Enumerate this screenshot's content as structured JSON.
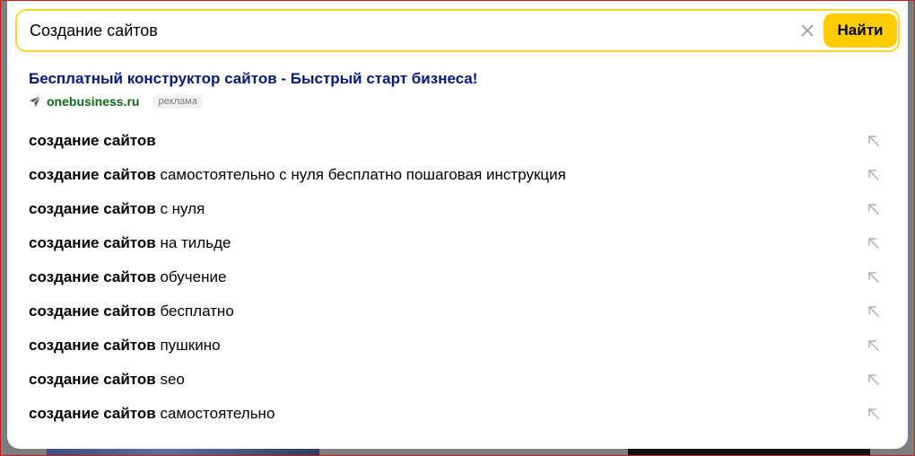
{
  "search": {
    "value": "Создание сайтов",
    "button_label": "Найти"
  },
  "ad": {
    "title": "Бесплатный конструктор сайтов - Быстрый старт бизнеса!",
    "domain": "onebusiness.ru",
    "badge": "реклама"
  },
  "suggestions": [
    {
      "bold": "создание сайтов",
      "rest": ""
    },
    {
      "bold": "создание сайтов",
      "rest": " самостоятельно с нуля бесплатно пошаговая инструкция"
    },
    {
      "bold": "создание сайтов",
      "rest": " с нуля"
    },
    {
      "bold": "создание сайтов",
      "rest": " на тильде"
    },
    {
      "bold": "создание сайтов",
      "rest": " обучение"
    },
    {
      "bold": "создание сайтов",
      "rest": " бесплатно"
    },
    {
      "bold": "создание сайтов",
      "rest": " пушкино"
    },
    {
      "bold": "создание сайтов",
      "rest": " seo"
    },
    {
      "bold": "создание сайтов",
      "rest": " самостоятельно"
    }
  ],
  "icons": {
    "clear": "close-icon",
    "ad_marker": "navigation-arrow-icon",
    "fill": "arrow-up-left-icon"
  },
  "colors": {
    "accent": "#ffcc00",
    "search_border": "#fed42b",
    "ad_title": "#001a80",
    "ad_domain": "#0a6b14"
  }
}
